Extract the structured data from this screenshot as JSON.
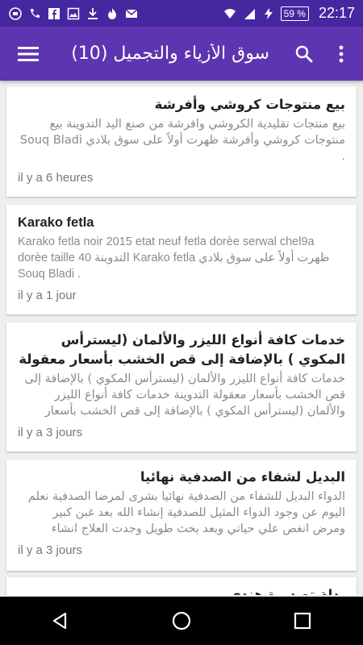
{
  "status_bar": {
    "battery": "59 %",
    "time": "22:17"
  },
  "app_bar": {
    "title": "سوق الأزياء والتجميل (10)"
  },
  "cards": [
    {
      "title": "بيع منتوجات كروشي وأفرشة",
      "body": "بيع منتجات تقليدية الكروشي وافرشة من صنع اليد التدوينة بيع منتوجات كروشي وأفرشة ظهرت أولاً على سوق بلادي Souq Bladi .",
      "time": "il y a 6 heures",
      "dir": "rtl"
    },
    {
      "title": "Karako fetla",
      "body": "Karako fetla noir 2015 etat neuf fetla dorèe serwal chel9a dorèe taille 40 التدوينة Karako fetla ظهرت أولاً على سوق بلادي Souq Bladi .",
      "time": "il y a 1 jour",
      "dir": "ltr"
    },
    {
      "title": "خدمات كافة أنواع الليزر والألمان (ليسترأس المكوي ) بالإضافة إلى قص الخشب بأسعار معقولة",
      "body": "خدمات كافة أنواع الليزر والألمان (ليسترأس المكوي ) بالإضافة إلى قص الخشب بأسعار معقولة التدوينة خدمات كافة أنواع الليزر والألمان (ليسترأس المكوي ) بالإضافة إلى قص الخشب بأسعار",
      "time": "il y a 3 jours",
      "dir": "rtl"
    },
    {
      "title": "البديل لشفاء من الصدفية نهائيا",
      "body": "الدواء البديل للشفاء من الصدفية نهائيا بشرى لمرضا الصدفية نعلم اليوم عن وجود الدواء المثيل للصدفية إنشاء الله بعد غبن كبير ومرض انغص علي حياتي وبعد بحث طويل وجدت العلاج انشاء",
      "time": "il y a 3 jours",
      "dir": "rtl"
    },
    {
      "title": "بدلة تصديرة هندي",
      "body": "",
      "time": "",
      "dir": "rtl"
    }
  ]
}
